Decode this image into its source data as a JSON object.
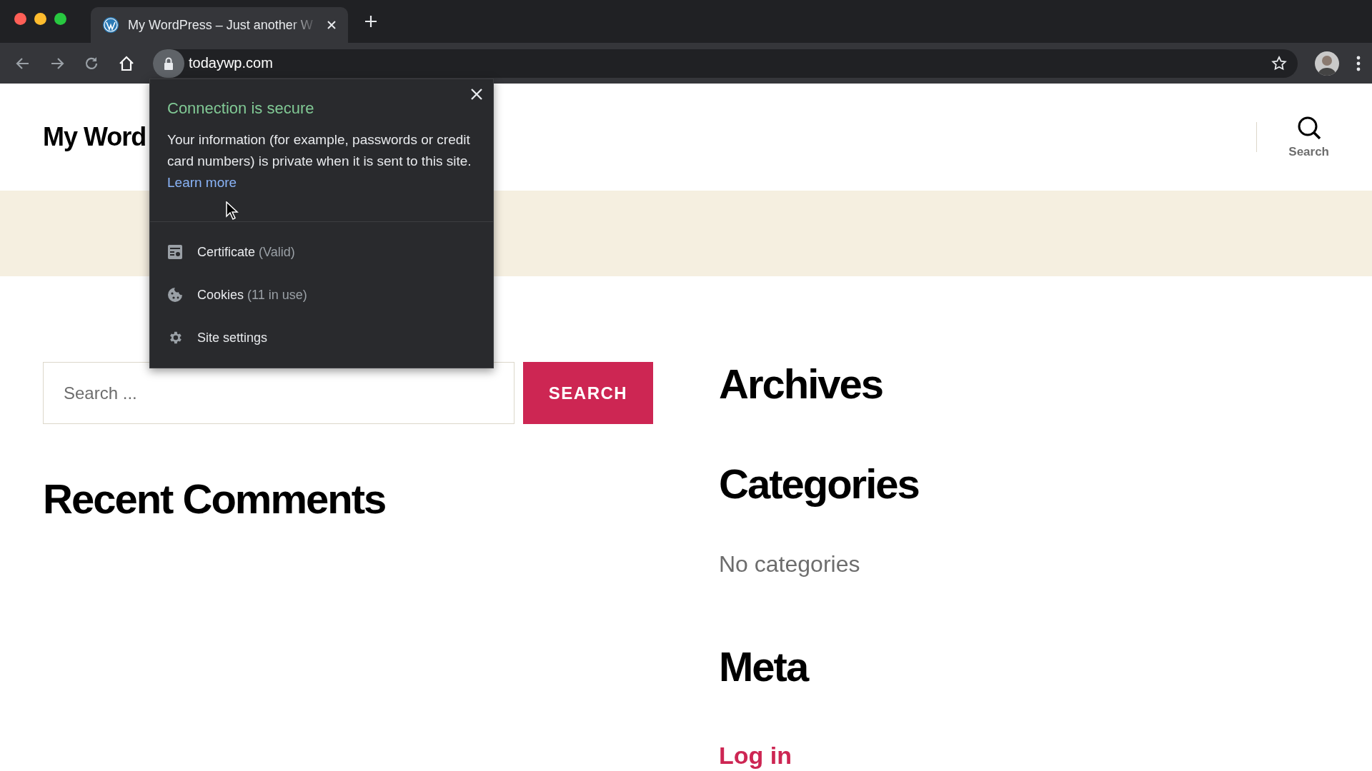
{
  "browser": {
    "tab": {
      "title": "My WordPress – Just another W",
      "selected": true
    },
    "url": "todaywp.com"
  },
  "site": {
    "title": "My Word",
    "search_toggle": "Search"
  },
  "widgets": {
    "search": {
      "placeholder": "Search ...",
      "button": "SEARCH"
    },
    "left": [
      {
        "kind": "heading",
        "text": "Recent Comments"
      }
    ],
    "right": [
      {
        "kind": "heading",
        "text": "Archives"
      },
      {
        "kind": "heading",
        "text": "Categories"
      },
      {
        "kind": "note",
        "text": "No categories"
      },
      {
        "kind": "heading",
        "text": "Meta"
      },
      {
        "kind": "link",
        "text": "Log in"
      }
    ]
  },
  "popup": {
    "title": "Connection is secure",
    "body": "Your information (for example, passwords or credit card numbers) is private when it is sent to this site.",
    "link": "Learn more",
    "items": [
      {
        "kind": "certificate",
        "label": "Certificate",
        "detail": "(Valid)"
      },
      {
        "kind": "cookies",
        "label": "Cookies",
        "detail": "(11 in use)"
      },
      {
        "kind": "settings",
        "label": "Site settings"
      }
    ]
  }
}
